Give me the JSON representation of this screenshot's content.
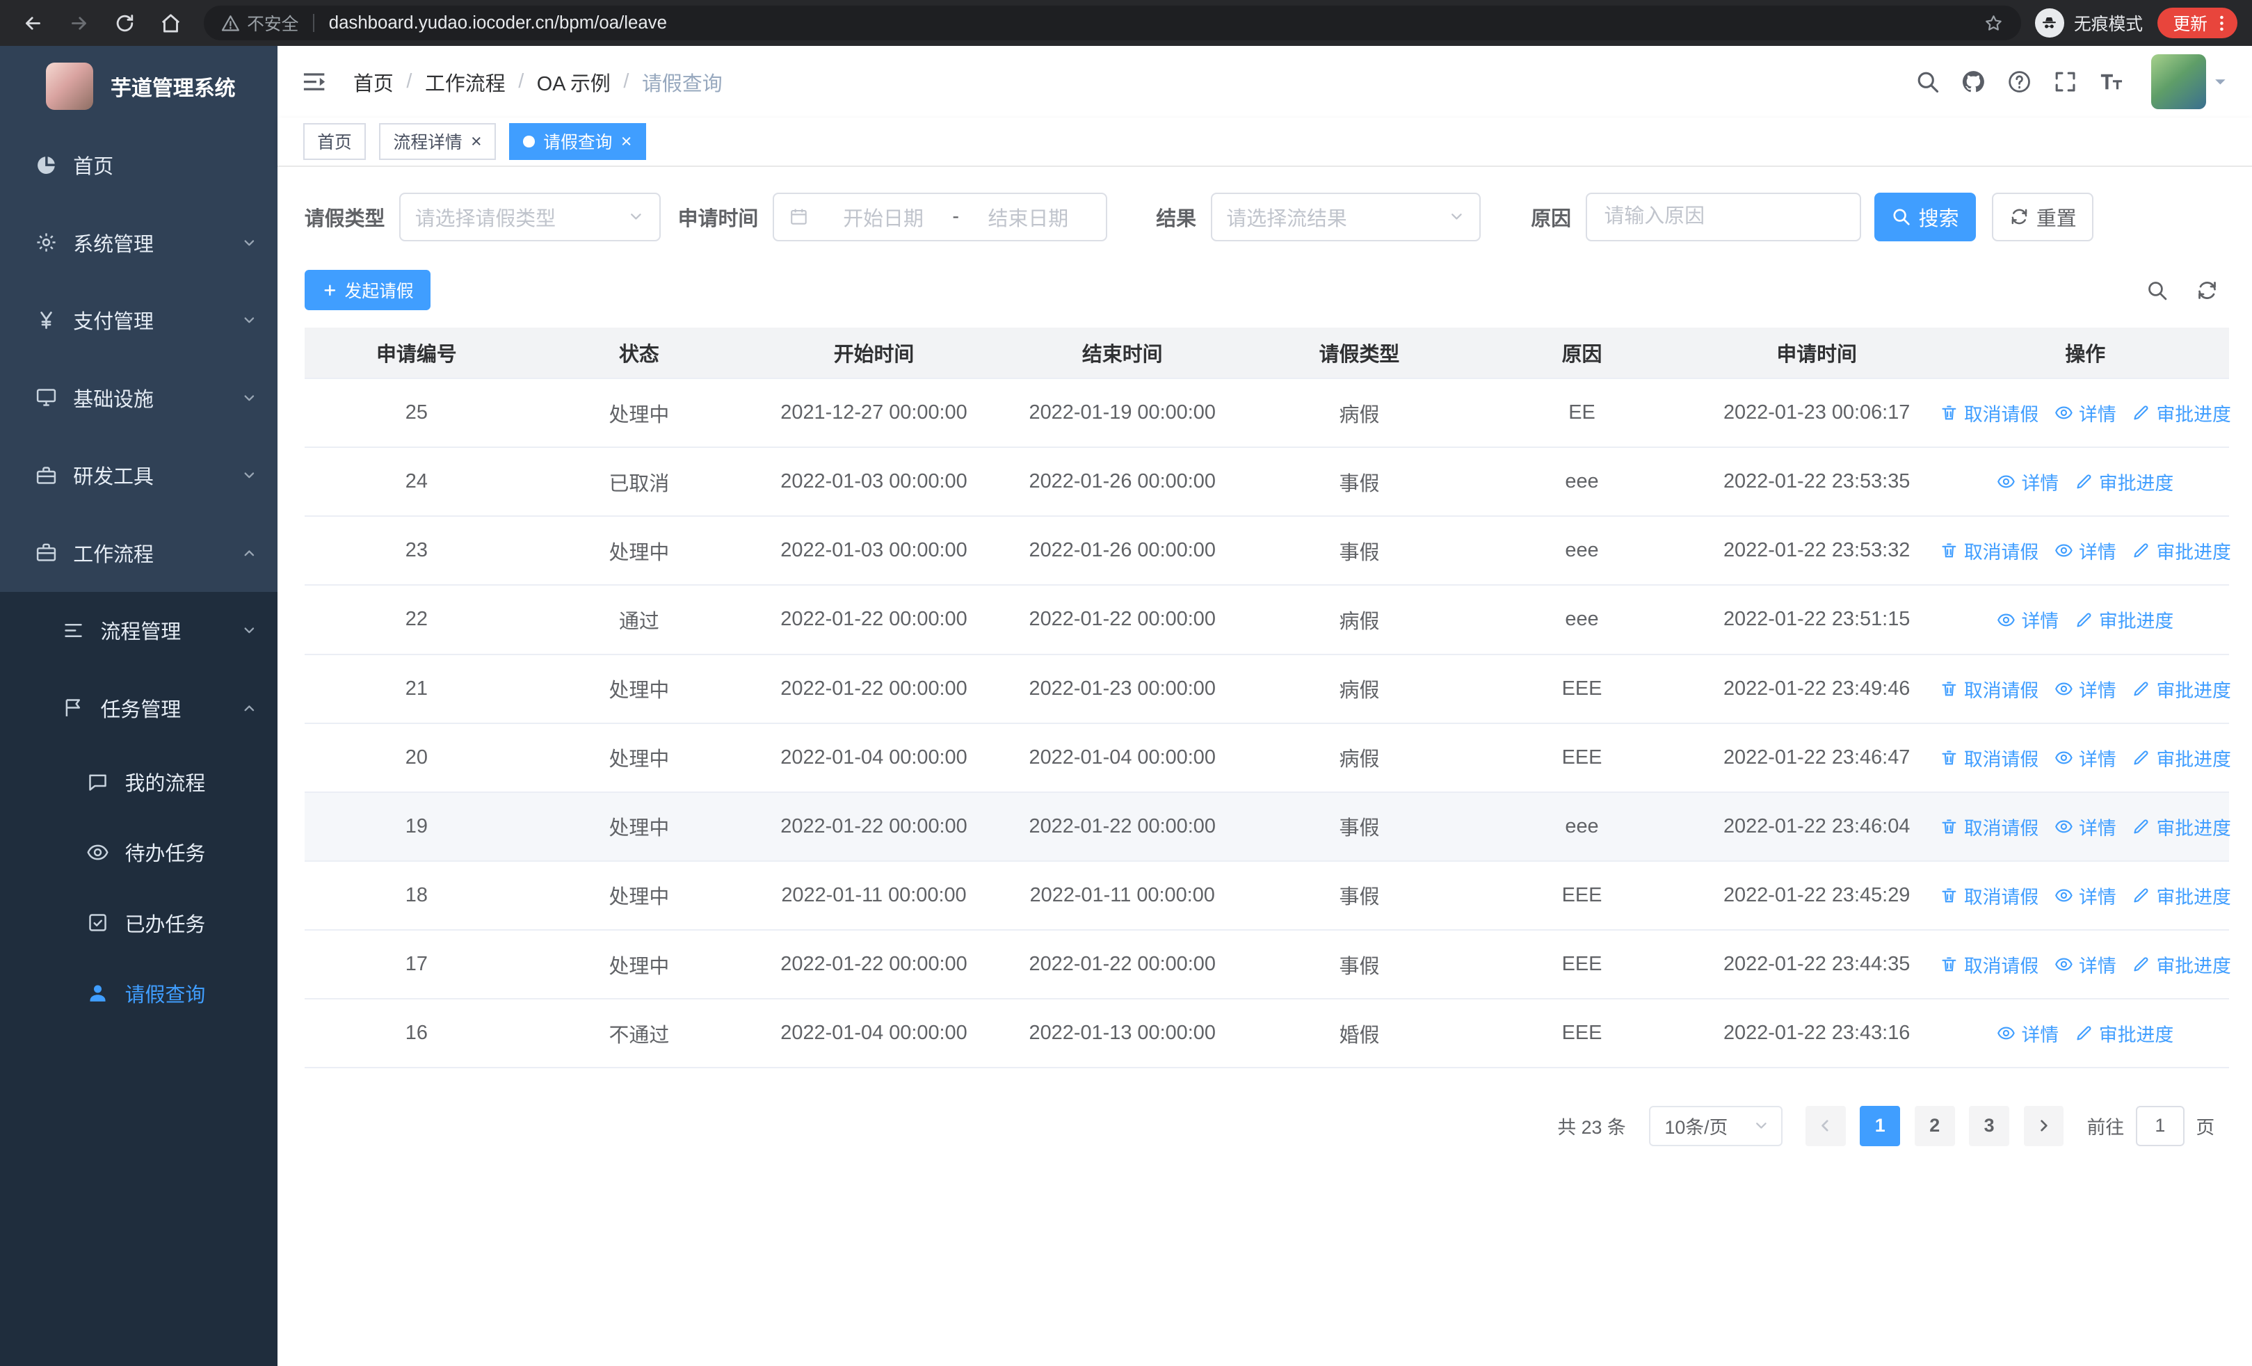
{
  "browser": {
    "security_label": "不安全",
    "url": "dashboard.yudao.iocoder.cn/bpm/oa/leave",
    "incognito_label": "无痕模式",
    "update_label": "更新"
  },
  "sidebar": {
    "title": "芋道管理系统",
    "menu": [
      {
        "label": "首页",
        "icon": "dashboard-icon"
      },
      {
        "label": "系统管理",
        "icon": "gear-icon"
      },
      {
        "label": "支付管理",
        "icon": "yen-icon"
      },
      {
        "label": "基础设施",
        "icon": "monitor-icon"
      },
      {
        "label": "研发工具",
        "icon": "toolbox-icon"
      },
      {
        "label": "工作流程",
        "icon": "briefcase-icon",
        "expanded": true,
        "children": [
          {
            "label": "流程管理",
            "icon": "flow-icon"
          },
          {
            "label": "任务管理",
            "icon": "tasks-icon",
            "expanded": true,
            "children": [
              {
                "label": "我的流程",
                "icon": "chat-icon"
              },
              {
                "label": "待办任务",
                "icon": "eye-icon"
              },
              {
                "label": "已办任务",
                "icon": "done-icon"
              },
              {
                "label": "请假查询",
                "icon": "user-icon",
                "active": true
              }
            ]
          }
        ]
      }
    ]
  },
  "header": {
    "breadcrumb": [
      "首页",
      "工作流程",
      "OA 示例",
      "请假查询"
    ],
    "tabs": [
      {
        "label": "首页",
        "closable": false,
        "active": false
      },
      {
        "label": "流程详情",
        "closable": true,
        "active": false
      },
      {
        "label": "请假查询",
        "closable": true,
        "active": true
      }
    ],
    "close_glyph": "×"
  },
  "filter": {
    "leave_type_label": "请假类型",
    "leave_type_placeholder": "请选择请假类型",
    "apply_time_label": "申请时间",
    "start_date_placeholder": "开始日期",
    "date_separator": "-",
    "end_date_placeholder": "结束日期",
    "result_label": "结果",
    "result_placeholder": "请选择流结果",
    "reason_label": "原因",
    "reason_placeholder": "请输入原因",
    "search_label": "搜索",
    "reset_label": "重置"
  },
  "toolbar": {
    "create_label": "发起请假"
  },
  "table": {
    "columns": [
      "申请编号",
      "状态",
      "开始时间",
      "结束时间",
      "请假类型",
      "原因",
      "申请时间",
      "操作"
    ],
    "action_labels": {
      "cancel": "取消请假",
      "detail": "详情",
      "progress": "审批进度"
    },
    "rows": [
      {
        "id": "25",
        "status": "处理中",
        "start": "2021-12-27 00:00:00",
        "end": "2022-01-19 00:00:00",
        "type": "病假",
        "reason": "EE",
        "applied": "2022-01-23 00:06:17",
        "actions": [
          "cancel",
          "detail",
          "progress"
        ]
      },
      {
        "id": "24",
        "status": "已取消",
        "start": "2022-01-03 00:00:00",
        "end": "2022-01-26 00:00:00",
        "type": "事假",
        "reason": "eee",
        "applied": "2022-01-22 23:53:35",
        "actions": [
          "detail",
          "progress"
        ]
      },
      {
        "id": "23",
        "status": "处理中",
        "start": "2022-01-03 00:00:00",
        "end": "2022-01-26 00:00:00",
        "type": "事假",
        "reason": "eee",
        "applied": "2022-01-22 23:53:32",
        "actions": [
          "cancel",
          "detail",
          "progress"
        ]
      },
      {
        "id": "22",
        "status": "通过",
        "start": "2022-01-22 00:00:00",
        "end": "2022-01-22 00:00:00",
        "type": "病假",
        "reason": "eee",
        "applied": "2022-01-22 23:51:15",
        "actions": [
          "detail",
          "progress"
        ]
      },
      {
        "id": "21",
        "status": "处理中",
        "start": "2022-01-22 00:00:00",
        "end": "2022-01-23 00:00:00",
        "type": "病假",
        "reason": "EEE",
        "applied": "2022-01-22 23:49:46",
        "actions": [
          "cancel",
          "detail",
          "progress"
        ]
      },
      {
        "id": "20",
        "status": "处理中",
        "start": "2022-01-04 00:00:00",
        "end": "2022-01-04 00:00:00",
        "type": "病假",
        "reason": "EEE",
        "applied": "2022-01-22 23:46:47",
        "actions": [
          "cancel",
          "detail",
          "progress"
        ]
      },
      {
        "id": "19",
        "status": "处理中",
        "start": "2022-01-22 00:00:00",
        "end": "2022-01-22 00:00:00",
        "type": "事假",
        "reason": "eee",
        "applied": "2022-01-22 23:46:04",
        "actions": [
          "cancel",
          "detail",
          "progress"
        ],
        "hover": true
      },
      {
        "id": "18",
        "status": "处理中",
        "start": "2022-01-11 00:00:00",
        "end": "2022-01-11 00:00:00",
        "type": "事假",
        "reason": "EEE",
        "applied": "2022-01-22 23:45:29",
        "actions": [
          "cancel",
          "detail",
          "progress"
        ]
      },
      {
        "id": "17",
        "status": "处理中",
        "start": "2022-01-22 00:00:00",
        "end": "2022-01-22 00:00:00",
        "type": "事假",
        "reason": "EEE",
        "applied": "2022-01-22 23:44:35",
        "actions": [
          "cancel",
          "detail",
          "progress"
        ]
      },
      {
        "id": "16",
        "status": "不通过",
        "start": "2022-01-04 00:00:00",
        "end": "2022-01-13 00:00:00",
        "type": "婚假",
        "reason": "EEE",
        "applied": "2022-01-22 23:43:16",
        "actions": [
          "detail",
          "progress"
        ]
      }
    ]
  },
  "pagination": {
    "total_text": "共 23 条",
    "page_size": "10条/页",
    "pages": [
      "1",
      "2",
      "3"
    ],
    "active_page": "1",
    "jumper_prefix": "前往",
    "jumper_value": "1",
    "jumper_suffix": "页"
  },
  "colors": {
    "primary": "#409eff",
    "sidebar_bg": "#304156",
    "submenu_bg": "#1f2d3d",
    "update_chip": "#e8453c"
  }
}
